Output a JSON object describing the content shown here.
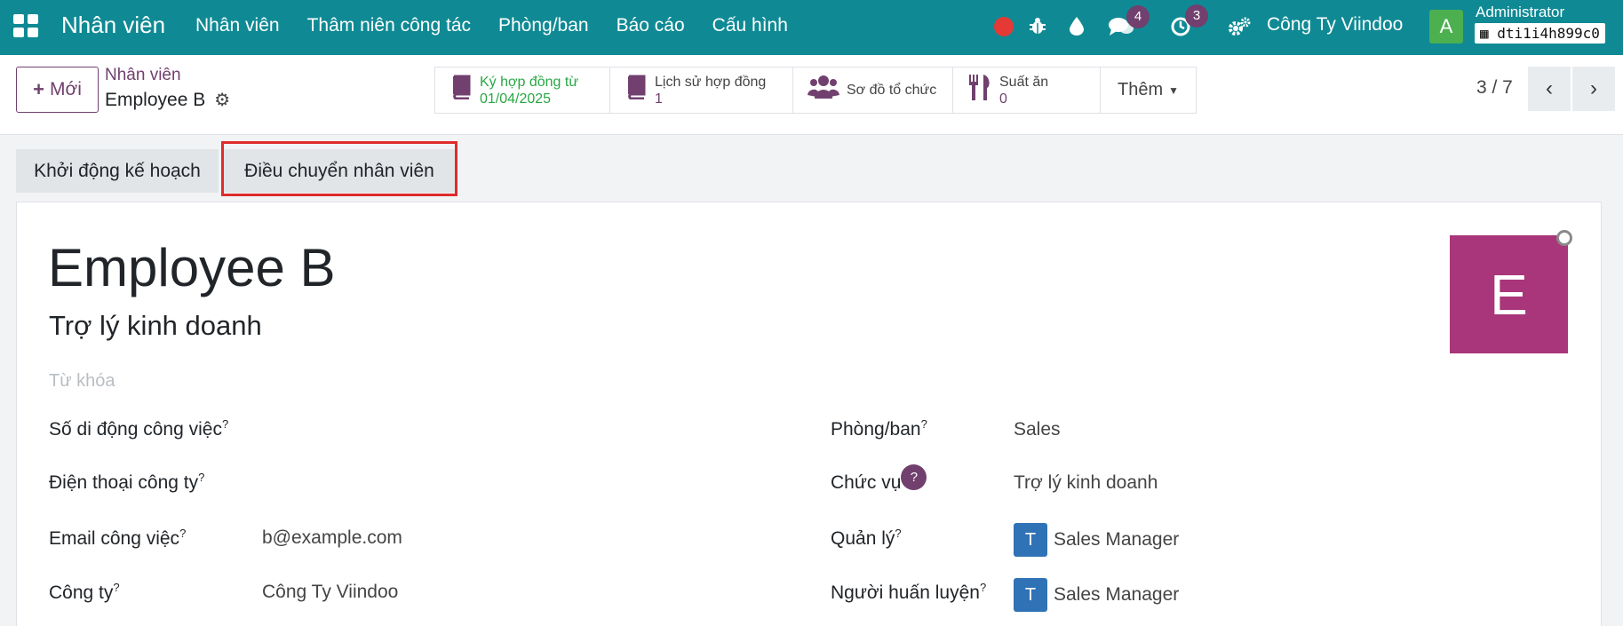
{
  "navbar": {
    "app_name": "Nhân viên",
    "menu": [
      "Nhân viên",
      "Thâm niên công tác",
      "Phòng/ban",
      "Báo cáo",
      "Cấu hình"
    ],
    "messages_count": "4",
    "activities_count": "3",
    "company": "Công Ty Viindoo",
    "avatar_letter": "A",
    "user_name": "Administrator",
    "database": "dti1i4h899c0"
  },
  "control_panel": {
    "new_button": "Mới",
    "breadcrumb_parent": "Nhân viên",
    "breadcrumb_current": "Employee B",
    "smart_buttons": [
      {
        "label": "Ký hợp đồng từ",
        "value": "01/04/2025"
      },
      {
        "label": "Lịch sử hợp đồng",
        "value": "1"
      },
      {
        "label": "Sơ đồ tổ chức",
        "value": ""
      },
      {
        "label": "Suất ăn",
        "value": "0"
      }
    ],
    "more_label": "Thêm",
    "pager": "3 / 7"
  },
  "actions": {
    "start_plan": "Khởi động kế hoạch",
    "transfer": "Điều chuyển nhân viên"
  },
  "form": {
    "name": "Employee B",
    "job_title": "Trợ lý kinh doanh",
    "tags_placeholder": "Từ khóa",
    "photo_letter": "E",
    "left_fields": [
      {
        "label": "Số di động công việc",
        "value": ""
      },
      {
        "label": "Điện thoại công ty",
        "value": ""
      },
      {
        "label": "Email công việc",
        "value": "b@example.com"
      },
      {
        "label": "Công ty",
        "value": "Công Ty Viindoo"
      }
    ],
    "right_fields": [
      {
        "label": "Phòng/ban",
        "value": "Sales"
      },
      {
        "label": "Chức vụ",
        "value": "Trợ lý kinh doanh"
      },
      {
        "label": "Quản lý",
        "value": "Sales Manager",
        "avatar": "T"
      },
      {
        "label": "Người huấn luyện",
        "value": "Sales Manager",
        "avatar": "T"
      }
    ]
  },
  "colors": {
    "navbar": "#0f8a94",
    "brand": "#71406e",
    "photo_bg": "#a9357a",
    "highlight": "#e02b2b"
  }
}
